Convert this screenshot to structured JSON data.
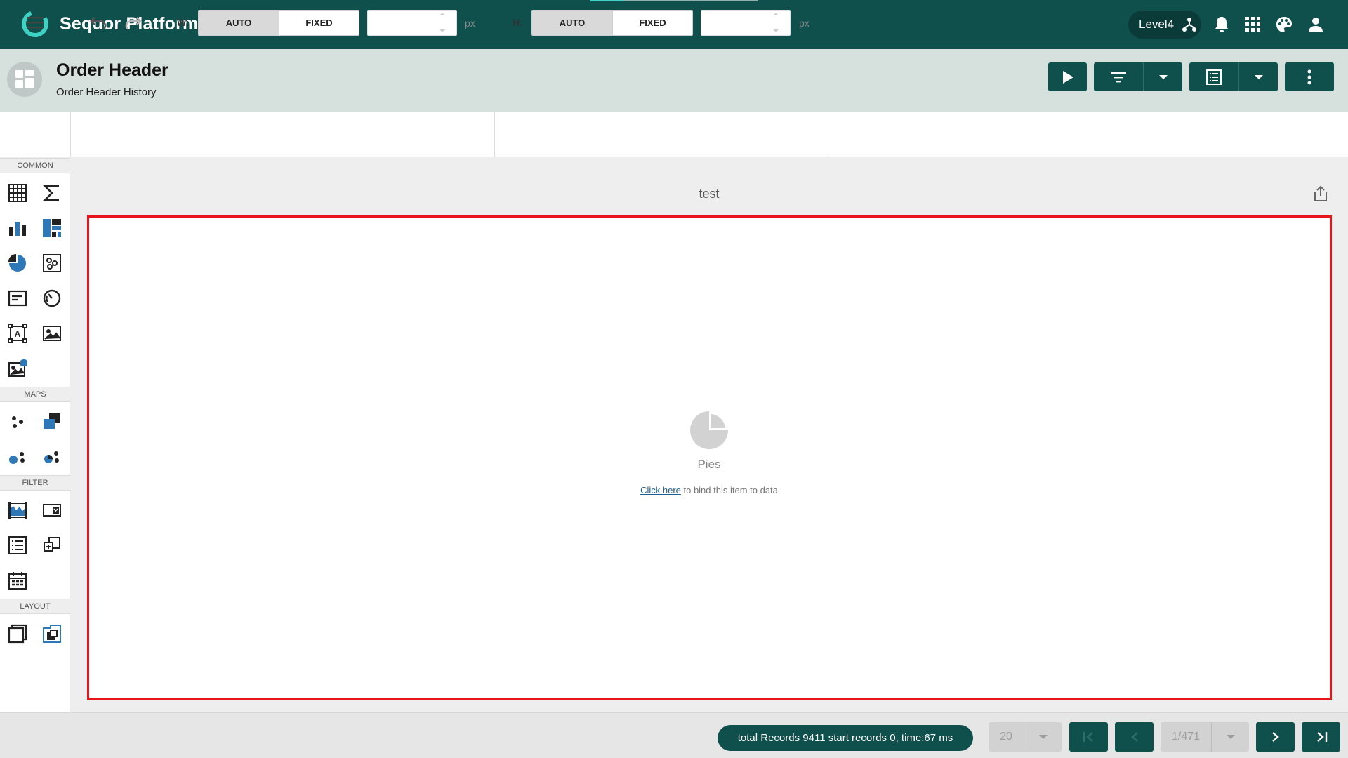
{
  "app": {
    "title": "Sequor Platform",
    "level": "Level4"
  },
  "header": {
    "title": "Order Header",
    "subtitle": "Order Header History"
  },
  "toolbar": {
    "width_label": "W:",
    "height_label": "H:",
    "auto_label": "AUTO",
    "fixed_label": "FIXED",
    "unit": "px",
    "width_value": "",
    "height_value": ""
  },
  "palette": {
    "common_label": "COMMON",
    "maps_label": "MAPS",
    "filter_label": "FILTER",
    "layout_label": "LAYOUT"
  },
  "canvas": {
    "item_title": "test",
    "placeholder_title": "Pies",
    "bind_link": "Click here",
    "bind_text": " to bind this item to data"
  },
  "footer": {
    "status": "total Records 9411 start records 0, time:67 ms",
    "page_size": "20",
    "page_indicator": "1/471"
  },
  "colors": {
    "brand": "#0f4f4c",
    "accent": "#3fd1c4",
    "selection": "#e8141c",
    "icon_blue": "#2f78b7"
  }
}
